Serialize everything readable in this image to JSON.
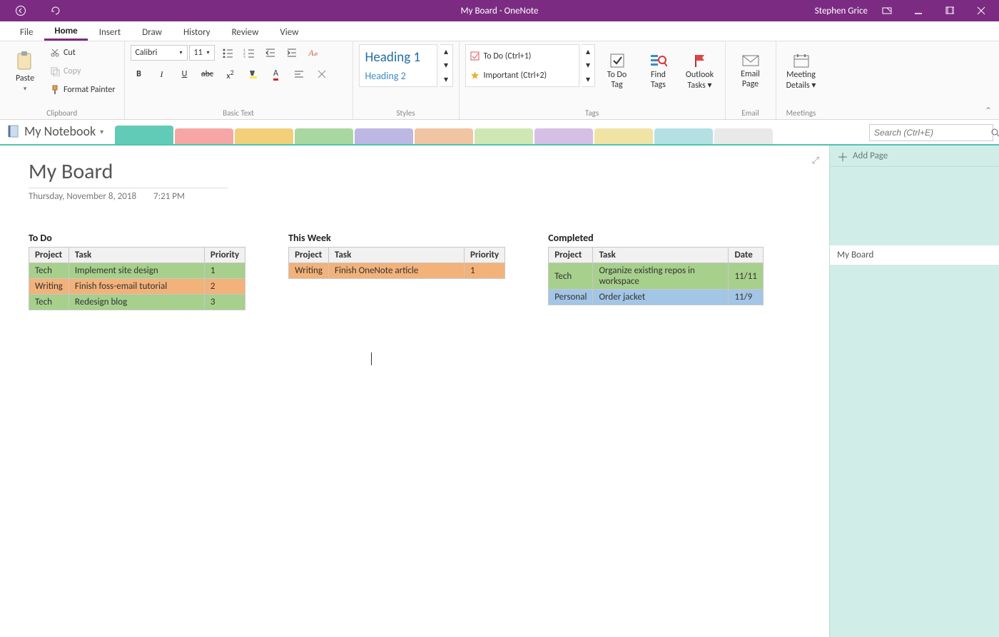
{
  "app": {
    "title": "My Board  -  OneNote",
    "user": "Stephen Grice"
  },
  "ribbonTabs": [
    "File",
    "Home",
    "Insert",
    "Draw",
    "History",
    "Review",
    "View"
  ],
  "ribbonActive": "Home",
  "clipboard": {
    "paste": "Paste",
    "cut": "Cut",
    "copy": "Copy",
    "formatPainter": "Format Painter",
    "groupLabel": "Clipboard"
  },
  "basicText": {
    "font": "Calibri",
    "size": "11",
    "groupLabel": "Basic Text"
  },
  "styles": {
    "h1": "Heading 1",
    "h2": "Heading 2",
    "groupLabel": "Styles"
  },
  "tags": {
    "items": [
      {
        "label": "To Do (Ctrl+1)",
        "icon": "checkbox"
      },
      {
        "label": "Important (Ctrl+2)",
        "icon": "star"
      }
    ],
    "todo": "To Do\nTag",
    "find": "Find\nTags",
    "outlook": "Outlook\nTasks ▾",
    "groupLabel": "Tags"
  },
  "email": {
    "btn": "Email\nPage",
    "groupLabel": "Email"
  },
  "meetings": {
    "btn": "Meeting\nDetails ▾",
    "groupLabel": "Meetings"
  },
  "notebook": {
    "name": "My Notebook"
  },
  "searchPlaceholder": "Search (Ctrl+E)",
  "page": {
    "title": "My Board",
    "date": "Thursday, November 8, 2018",
    "time": "7:21 PM"
  },
  "pagePane": {
    "addPage": "Add Page",
    "pages": [
      "My Board"
    ]
  },
  "sectionColors": [
    "#62cbb7",
    "#f7a6a6",
    "#f2d07a",
    "#a9d7a0",
    "#bcb7e3",
    "#f1c4a3",
    "#cfe7b5",
    "#d6bfe4",
    "#f0e3a3",
    "#b4e0e4",
    "#e9e9e9"
  ],
  "board": {
    "columns": [
      {
        "title": "To Do",
        "headers": [
          "Project",
          "Task",
          "Priority"
        ],
        "rows": [
          {
            "cells": [
              "Tech",
              "Implement site design",
              "1"
            ],
            "color": "green"
          },
          {
            "cells": [
              "Writing",
              "Finish foss-email tutorial",
              "2"
            ],
            "color": "orange"
          },
          {
            "cells": [
              "Tech",
              "Redesign blog",
              "3"
            ],
            "color": "green"
          }
        ],
        "widths": [
          54,
          190,
          52
        ]
      },
      {
        "title": "This Week",
        "headers": [
          "Project",
          "Task",
          "Priority"
        ],
        "rows": [
          {
            "cells": [
              "Writing",
              "Finish OneNote article",
              "1"
            ],
            "color": "orange"
          }
        ],
        "widths": [
          54,
          190,
          52
        ]
      },
      {
        "title": "Completed",
        "headers": [
          "Project",
          "Task",
          "Date"
        ],
        "rows": [
          {
            "cells": [
              "Tech",
              "Organize existing repos in workspace",
              "11/11"
            ],
            "color": "green"
          },
          {
            "cells": [
              "Personal",
              "Order jacket",
              "11/9"
            ],
            "color": "blue"
          }
        ],
        "widths": [
          60,
          190,
          48
        ]
      }
    ]
  }
}
